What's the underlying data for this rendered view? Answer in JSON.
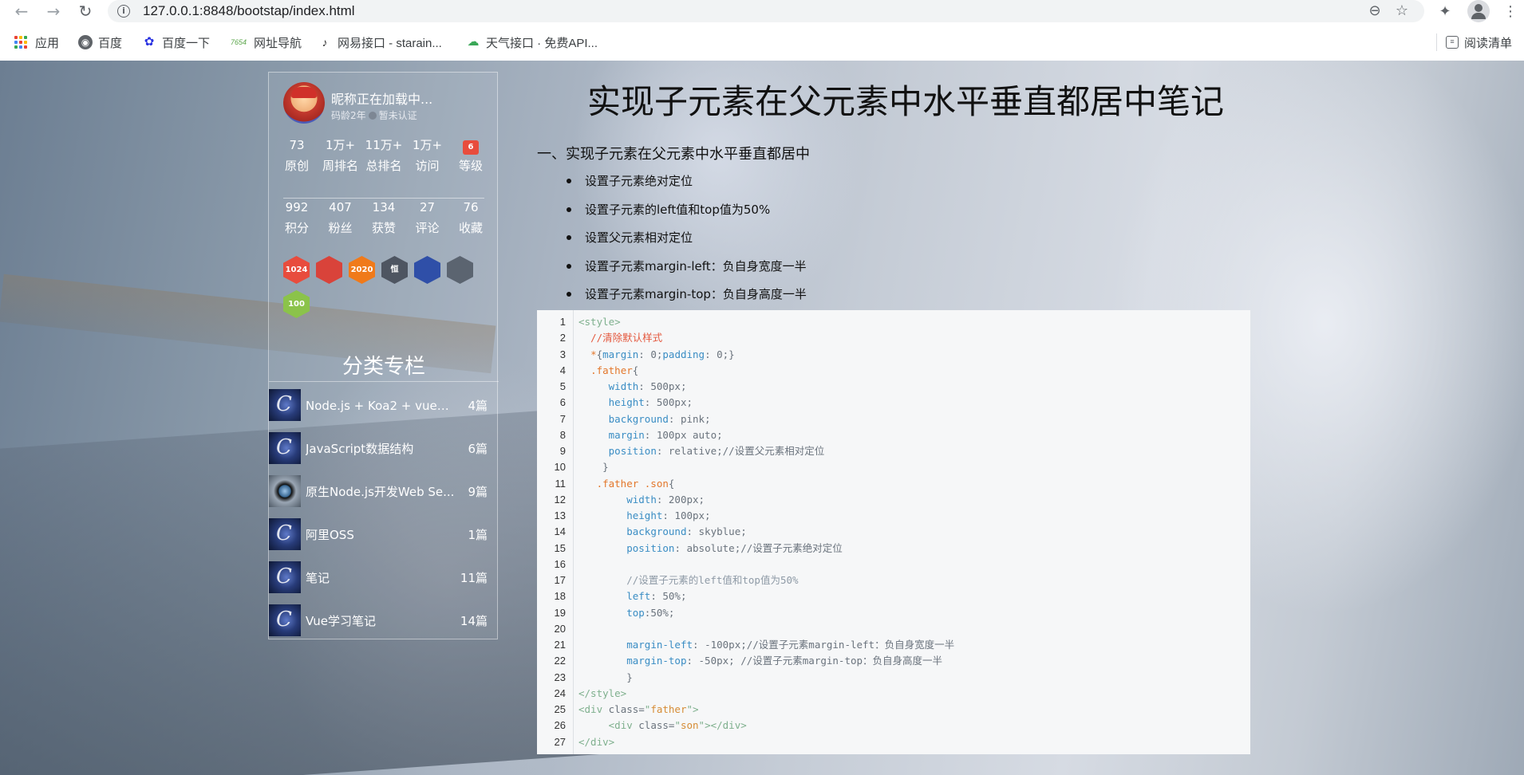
{
  "browser": {
    "url": "127.0.0.1:8848/bootstap/index.html",
    "bookmarks": [
      {
        "label": "应用",
        "icon": "apps-grid-icon"
      },
      {
        "label": "百度",
        "icon": "globe-icon"
      },
      {
        "label": "百度一下",
        "icon": "baidu-paw-icon"
      },
      {
        "label": "网址导航",
        "icon": "7654-icon",
        "icon_text": "7654"
      },
      {
        "label": "网易接口 - starain...",
        "icon": "netease-icon"
      },
      {
        "label": "天气接口 · 免费API...",
        "icon": "weather-icon"
      }
    ],
    "reading_list": "阅读清单"
  },
  "sidebar": {
    "nickname": "昵称正在加载中...",
    "code_age": "码龄2年",
    "auth_status": "暂未认证",
    "stats_row1": [
      {
        "value": "73",
        "label": "原创"
      },
      {
        "value": "1万+",
        "label": "周排名"
      },
      {
        "value": "11万+",
        "label": "总排名"
      },
      {
        "value": "1万+",
        "label": "访问"
      },
      {
        "value": "",
        "label": "等级"
      }
    ],
    "stats_row2": [
      {
        "value": "992",
        "label": "积分"
      },
      {
        "value": "407",
        "label": "粉丝"
      },
      {
        "value": "134",
        "label": "获赞"
      },
      {
        "value": "27",
        "label": "评论"
      },
      {
        "value": "76",
        "label": "收藏"
      }
    ],
    "badges": [
      {
        "text": "1024",
        "color": "#e84c3d"
      },
      {
        "text": "",
        "color": "#d9433a"
      },
      {
        "text": "2020",
        "color": "#f07a1a"
      },
      {
        "text": "恒",
        "color": "#4e5561"
      },
      {
        "text": "",
        "color": "#2f4fa8"
      },
      {
        "text": "",
        "color": "#5b6470"
      },
      {
        "text": "100",
        "color": "#8bc34a"
      }
    ],
    "column_title": "分类专栏",
    "columns": [
      {
        "name": "Node.js + Koa2 + vue全...",
        "count": "4篇"
      },
      {
        "name": "JavaScript数据结构",
        "count": "6篇"
      },
      {
        "name": "原生Node.js开发Web Se...",
        "count": "9篇"
      },
      {
        "name": "阿里OSS",
        "count": "1篇"
      },
      {
        "name": "笔记",
        "count": "11篇"
      },
      {
        "name": "Vue学习笔记",
        "count": "14篇"
      }
    ]
  },
  "article": {
    "title": "实现子元素在父元素中水平垂直都居中笔记",
    "section_heading": "一、实现子元素在父元素中水平垂直都居中",
    "bullets": [
      "设置子元素绝对定位",
      "设置子元素的left值和top值为50%",
      "设置父元素相对定位",
      "设置子元素margin-left：负自身宽度一半",
      "设置子元素margin-top：负自身高度一半"
    ]
  },
  "code_lines": [
    {
      "n": "1",
      "parts": [
        [
          "c-tag",
          "<style>"
        ]
      ]
    },
    {
      "n": "2",
      "parts": [
        [
          "",
          "  "
        ],
        [
          "c-comment",
          "//清除默认样式"
        ]
      ]
    },
    {
      "n": "3",
      "parts": [
        [
          "",
          "  "
        ],
        [
          "c-sel",
          "*"
        ],
        [
          "c-val",
          "{"
        ],
        [
          "c-prop",
          "margin"
        ],
        [
          "c-val",
          ": 0;"
        ],
        [
          "c-prop",
          "padding"
        ],
        [
          "c-val",
          ": 0;}"
        ]
      ]
    },
    {
      "n": "4",
      "parts": [
        [
          "",
          "  "
        ],
        [
          "c-sel",
          ".father"
        ],
        [
          "c-val",
          "{"
        ]
      ]
    },
    {
      "n": "5",
      "parts": [
        [
          "",
          "     "
        ],
        [
          "c-prop",
          "width"
        ],
        [
          "c-val",
          ": 500px;"
        ]
      ]
    },
    {
      "n": "6",
      "parts": [
        [
          "",
          "     "
        ],
        [
          "c-prop",
          "height"
        ],
        [
          "c-val",
          ": 500px;"
        ]
      ]
    },
    {
      "n": "7",
      "parts": [
        [
          "",
          "     "
        ],
        [
          "c-prop",
          "background"
        ],
        [
          "c-val",
          ": pink;"
        ]
      ]
    },
    {
      "n": "8",
      "parts": [
        [
          "",
          "     "
        ],
        [
          "c-prop",
          "margin"
        ],
        [
          "c-val",
          ": 100px auto;"
        ]
      ]
    },
    {
      "n": "9",
      "parts": [
        [
          "",
          "     "
        ],
        [
          "c-prop",
          "position"
        ],
        [
          "c-val",
          ": relative;//设置父元素相对定位"
        ]
      ]
    },
    {
      "n": "10",
      "parts": [
        [
          "",
          "    "
        ],
        [
          "c-val",
          "}"
        ]
      ]
    },
    {
      "n": "11",
      "parts": [
        [
          "",
          "   "
        ],
        [
          "c-sel",
          ".father .son"
        ],
        [
          "c-val",
          "{"
        ]
      ]
    },
    {
      "n": "12",
      "parts": [
        [
          "",
          "        "
        ],
        [
          "c-prop",
          "width"
        ],
        [
          "c-val",
          ": 200px;"
        ]
      ]
    },
    {
      "n": "13",
      "parts": [
        [
          "",
          "        "
        ],
        [
          "c-prop",
          "height"
        ],
        [
          "c-val",
          ": 100px;"
        ]
      ]
    },
    {
      "n": "14",
      "parts": [
        [
          "",
          "        "
        ],
        [
          "c-prop",
          "background"
        ],
        [
          "c-val",
          ": skyblue;"
        ]
      ]
    },
    {
      "n": "15",
      "parts": [
        [
          "",
          "        "
        ],
        [
          "c-prop",
          "position"
        ],
        [
          "c-val",
          ": absolute;//设置子元素绝对定位"
        ]
      ]
    },
    {
      "n": "16",
      "parts": [
        [
          "",
          ""
        ]
      ]
    },
    {
      "n": "17",
      "parts": [
        [
          "",
          "        "
        ],
        [
          "c-comment2",
          "//设置子元素的left值和top值为50%"
        ]
      ]
    },
    {
      "n": "18",
      "parts": [
        [
          "",
          "        "
        ],
        [
          "c-prop",
          "left"
        ],
        [
          "c-val",
          ": 50%;"
        ]
      ]
    },
    {
      "n": "19",
      "parts": [
        [
          "",
          "        "
        ],
        [
          "c-prop",
          "top"
        ],
        [
          "c-val",
          ":50%;"
        ]
      ]
    },
    {
      "n": "20",
      "parts": [
        [
          "",
          ""
        ]
      ]
    },
    {
      "n": "21",
      "parts": [
        [
          "",
          "        "
        ],
        [
          "c-prop",
          "margin-left"
        ],
        [
          "c-val",
          ": -100px;//设置子元素margin-left：负自身宽度一半"
        ]
      ]
    },
    {
      "n": "22",
      "parts": [
        [
          "",
          "        "
        ],
        [
          "c-prop",
          "margin-top"
        ],
        [
          "c-val",
          ": -50px; //设置子元素margin-top：负自身高度一半"
        ]
      ]
    },
    {
      "n": "23",
      "parts": [
        [
          "",
          "        "
        ],
        [
          "c-val",
          "}"
        ]
      ]
    },
    {
      "n": "24",
      "parts": [
        [
          "c-tag",
          "</style>"
        ]
      ]
    },
    {
      "n": "25",
      "parts": [
        [
          "c-tag",
          "<div "
        ],
        [
          "c-val",
          "class="
        ],
        [
          "c-tag",
          "\""
        ],
        [
          "c-str",
          "father"
        ],
        [
          "c-tag",
          "\">"
        ]
      ]
    },
    {
      "n": "26",
      "parts": [
        [
          "",
          "     "
        ],
        [
          "c-tag",
          "<div "
        ],
        [
          "c-val",
          "class="
        ],
        [
          "c-tag",
          "\""
        ],
        [
          "c-str",
          "son"
        ],
        [
          "c-tag",
          "\"></div>"
        ]
      ]
    },
    {
      "n": "27",
      "parts": [
        [
          "c-tag",
          "</div>"
        ]
      ]
    }
  ]
}
